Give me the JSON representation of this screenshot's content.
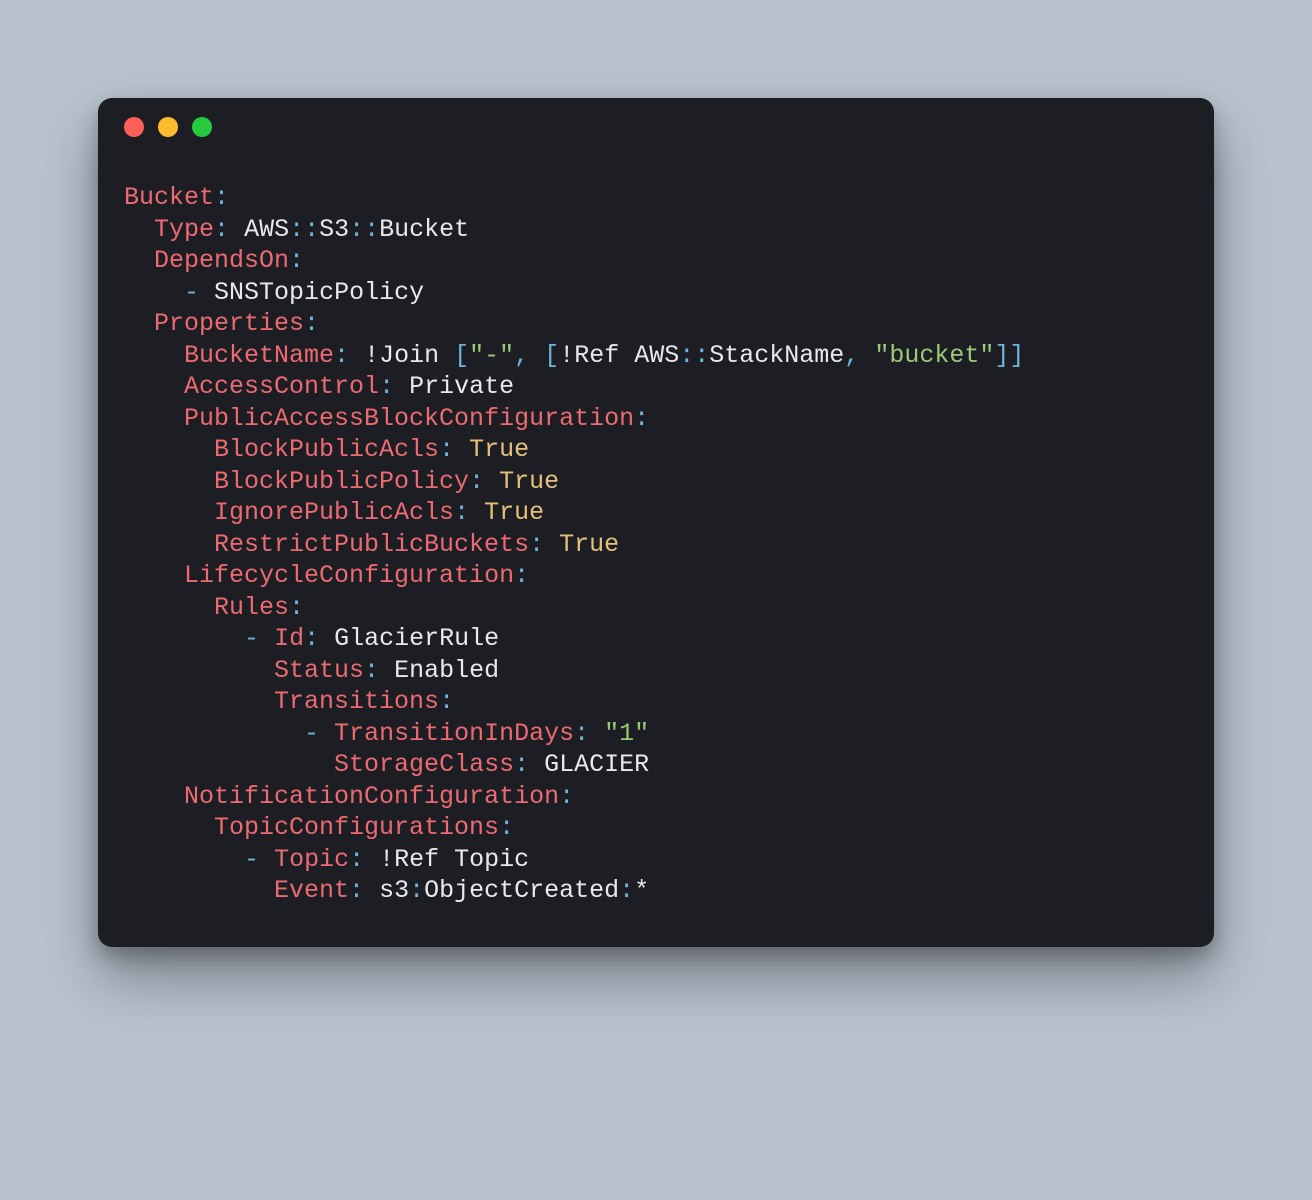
{
  "yaml": {
    "bucket_key": "Bucket",
    "type_key": "Type",
    "type_val_1": "AWS",
    "type_val_2": "S3",
    "type_val_3": "Bucket",
    "dependson_key": "DependsOn",
    "dependson_item": "SNSTopicPolicy",
    "properties_key": "Properties",
    "bucketname_key": "BucketName",
    "join_fn": "!Join",
    "join_dash": "\"-\"",
    "ref_fn": "!Ref",
    "aws_label": "AWS",
    "stackname_label": "StackName",
    "bucket_literal": "\"bucket\"",
    "accesscontrol_key": "AccessControl",
    "accesscontrol_val": "Private",
    "pabc_key": "PublicAccessBlockConfiguration",
    "bpacls_key": "BlockPublicAcls",
    "bpp_key": "BlockPublicPolicy",
    "ipa_key": "IgnorePublicAcls",
    "rpb_key": "RestrictPublicBuckets",
    "true_val": "True",
    "lifecycle_key": "LifecycleConfiguration",
    "rules_key": "Rules",
    "id_key": "Id",
    "id_val": "GlacierRule",
    "status_key": "Status",
    "status_val": "Enabled",
    "transitions_key": "Transitions",
    "tid_key": "TransitionInDays",
    "tid_val": "\"1\"",
    "sc_key": "StorageClass",
    "sc_val": "GLACIER",
    "nc_key": "NotificationConfiguration",
    "tc_key": "TopicConfigurations",
    "topic_key": "Topic",
    "topic_val": "Topic",
    "event_key": "Event",
    "event_s3": "s3",
    "event_oc": "ObjectCreated",
    "event_star": "*"
  }
}
